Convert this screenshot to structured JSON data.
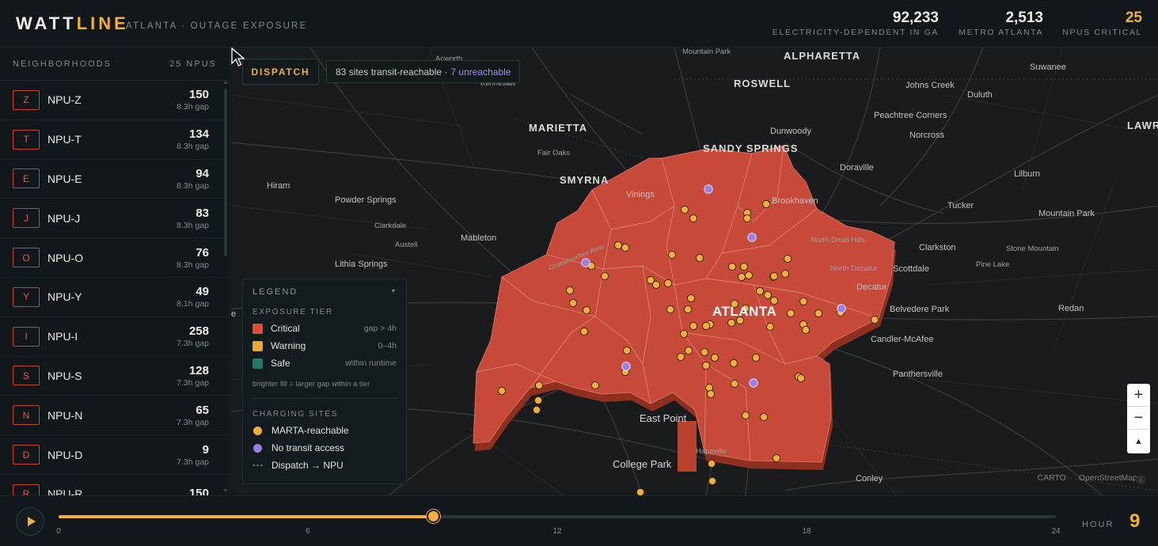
{
  "header": {
    "brand_part1": "WATT",
    "brand_part2": "LINE",
    "subtitle": "ATLANTA · OUTAGE EXPOSURE",
    "stats": [
      {
        "value": "92,233",
        "label": "ELECTRICITY-DEPENDENT IN GA"
      },
      {
        "value": "2,513",
        "label": "METRO ATLANTA"
      },
      {
        "value": "25",
        "label": "NPUS CRITICAL"
      }
    ]
  },
  "sidebar": {
    "title": "NEIGHBORHOODS",
    "count": "25 NPUS",
    "items": [
      {
        "code": "Z",
        "name": "NPU-Z",
        "value": "150",
        "gap": "8.3h gap"
      },
      {
        "code": "T",
        "name": "NPU-T",
        "value": "134",
        "gap": "8.3h gap"
      },
      {
        "code": "E",
        "name": "NPU-E",
        "value": "94",
        "gap": "8.3h gap"
      },
      {
        "code": "J",
        "name": "NPU-J",
        "value": "83",
        "gap": "8.3h gap"
      },
      {
        "code": "O",
        "name": "NPU-O",
        "value": "76",
        "gap": "8.3h gap"
      },
      {
        "code": "Y",
        "name": "NPU-Y",
        "value": "49",
        "gap": "8.1h gap"
      },
      {
        "code": "I",
        "name": "NPU-I",
        "value": "258",
        "gap": "7.3h gap"
      },
      {
        "code": "S",
        "name": "NPU-S",
        "value": "128",
        "gap": "7.3h gap"
      },
      {
        "code": "N",
        "name": "NPU-N",
        "value": "65",
        "gap": "7.3h gap"
      },
      {
        "code": "D",
        "name": "NPU-D",
        "value": "9",
        "gap": "7.3h gap"
      },
      {
        "code": "R",
        "name": "NPU-R",
        "value": "150",
        "gap": ""
      }
    ]
  },
  "map": {
    "dispatch_label": "DISPATCH",
    "reach_text": "83 sites transit-reachable ·",
    "unreach_text": "7 unreachable",
    "places": {
      "acworth": "Acworth",
      "mountain_park_n": "Mountain Park",
      "alpharetta": "ALPHARETTA",
      "suwanee": "Suwanee",
      "kennesaw": "Kennesaw",
      "roswell": "ROSWELL",
      "johns_creek": "Johns Creek",
      "duluth": "Duluth",
      "marietta": "MARIETTA",
      "peachtree_corners": "Peachtree Corners",
      "lawrenceville": "LAWRI",
      "fair_oaks": "Fair Oaks",
      "dunwoody": "Dunwoody",
      "norcross": "Norcross",
      "sandy_springs": "SANDY SPRINGS",
      "smyrna": "SMYRNA",
      "doraville": "Doraville",
      "lilburn": "Lilburn",
      "hiram": "Hiram",
      "vinings": "Vinings",
      "brookhaven": "Brookhaven",
      "powder_springs": "Powder Springs",
      "tucker": "Tucker",
      "mountain_park_e": "Mountain Park",
      "clarkdale": "Clarkdale",
      "mableton": "Mableton",
      "north_druid_hills": "North Druid Hills",
      "austell": "Austell",
      "clarkston": "Clarkston",
      "stone_mountain": "Stone Mountain",
      "lithia_springs": "Lithia Springs",
      "pine_lake": "Pine Lake",
      "north_decatur": "North Decatur",
      "scottdale": "Scottdale",
      "decatur": "Decatur",
      "atlanta": "ATLANTA",
      "belvedere_park": "Belvedere Park",
      "redan": "Redan",
      "candler_mcafee": "Candler-McAfee",
      "panthersville": "Panthersville",
      "east_point": "East Point",
      "hapeville": "Hapeville",
      "college_park": "College Park",
      "conley": "Conley",
      "chattahoochee": "Chattahoochee River",
      "edge_e": "e"
    },
    "attribution": [
      "CARTO",
      "OpenStreetMap"
    ],
    "zoom_in": "+",
    "zoom_out": "−",
    "compass": "▲"
  },
  "legend": {
    "title": "LEGEND",
    "collapse_icon": "▾",
    "tier_title": "EXPOSURE TIER",
    "tiers": [
      {
        "label": "Critical",
        "desc": "gap > 4h",
        "color": "#e04e38"
      },
      {
        "label": "Warning",
        "desc": "0–4h",
        "color": "#e8a92e"
      },
      {
        "label": "Safe",
        "desc": "within runtime",
        "color": "#1f7a64"
      }
    ],
    "note": "brighter fill = larger gap within a tier",
    "sites_title": "CHARGING SITES",
    "sites": [
      {
        "label": "MARTA-reachable",
        "color": "#f2b03a"
      },
      {
        "label": "No transit access",
        "color": "#9b7fe6"
      }
    ],
    "dispatch_mark": "---",
    "dispatch_label": "Dispatch → NPU"
  },
  "timeline": {
    "hour_label": "HOUR",
    "hour_value": "9",
    "progress": 0.375,
    "ticks": [
      "0",
      "6",
      "12",
      "18",
      "24"
    ]
  },
  "colors": {
    "accent": "#f2b03a",
    "critical": "#e04e38",
    "unreachable": "#9b7fe6"
  }
}
